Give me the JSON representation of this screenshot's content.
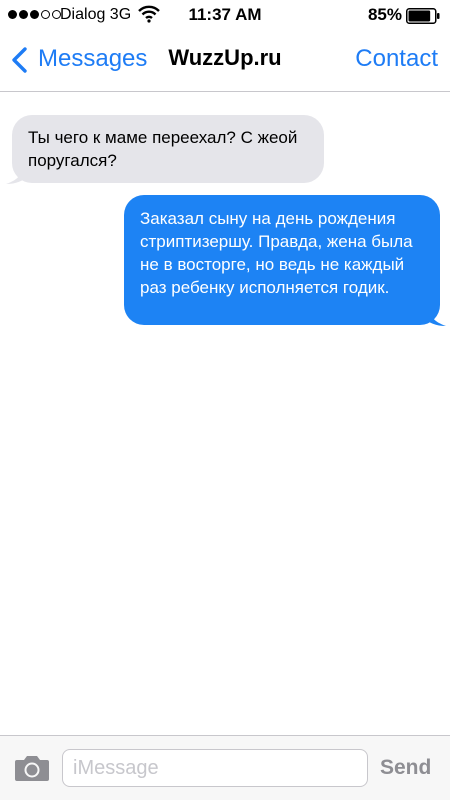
{
  "status_bar": {
    "carrier": "Dialog 3G",
    "time": "11:37 AM",
    "battery": "85%",
    "icons": [
      "signal-dots-icon",
      "wifi-icon",
      "battery-icon"
    ],
    "battery_level": 0.85
  },
  "nav": {
    "back_label": "Messages",
    "title": "WuzzUp.ru",
    "contact_label": "Contact",
    "accent": "#1e7cf5"
  },
  "messages": [
    {
      "direction": "incoming",
      "text": "Ты чего к маме переехал? С жеой поругался?",
      "color": "#e5e5ea"
    },
    {
      "direction": "outgoing",
      "text": "Заказал сыну на день рождения стриптизершу. Правда, жена была не в восторге, но ведь не каждый раз ребенку исполняется годик.",
      "color": "#1d83f4"
    }
  ],
  "composer": {
    "placeholder": "iMessage",
    "send_label": "Send",
    "icon": "camera-icon"
  }
}
